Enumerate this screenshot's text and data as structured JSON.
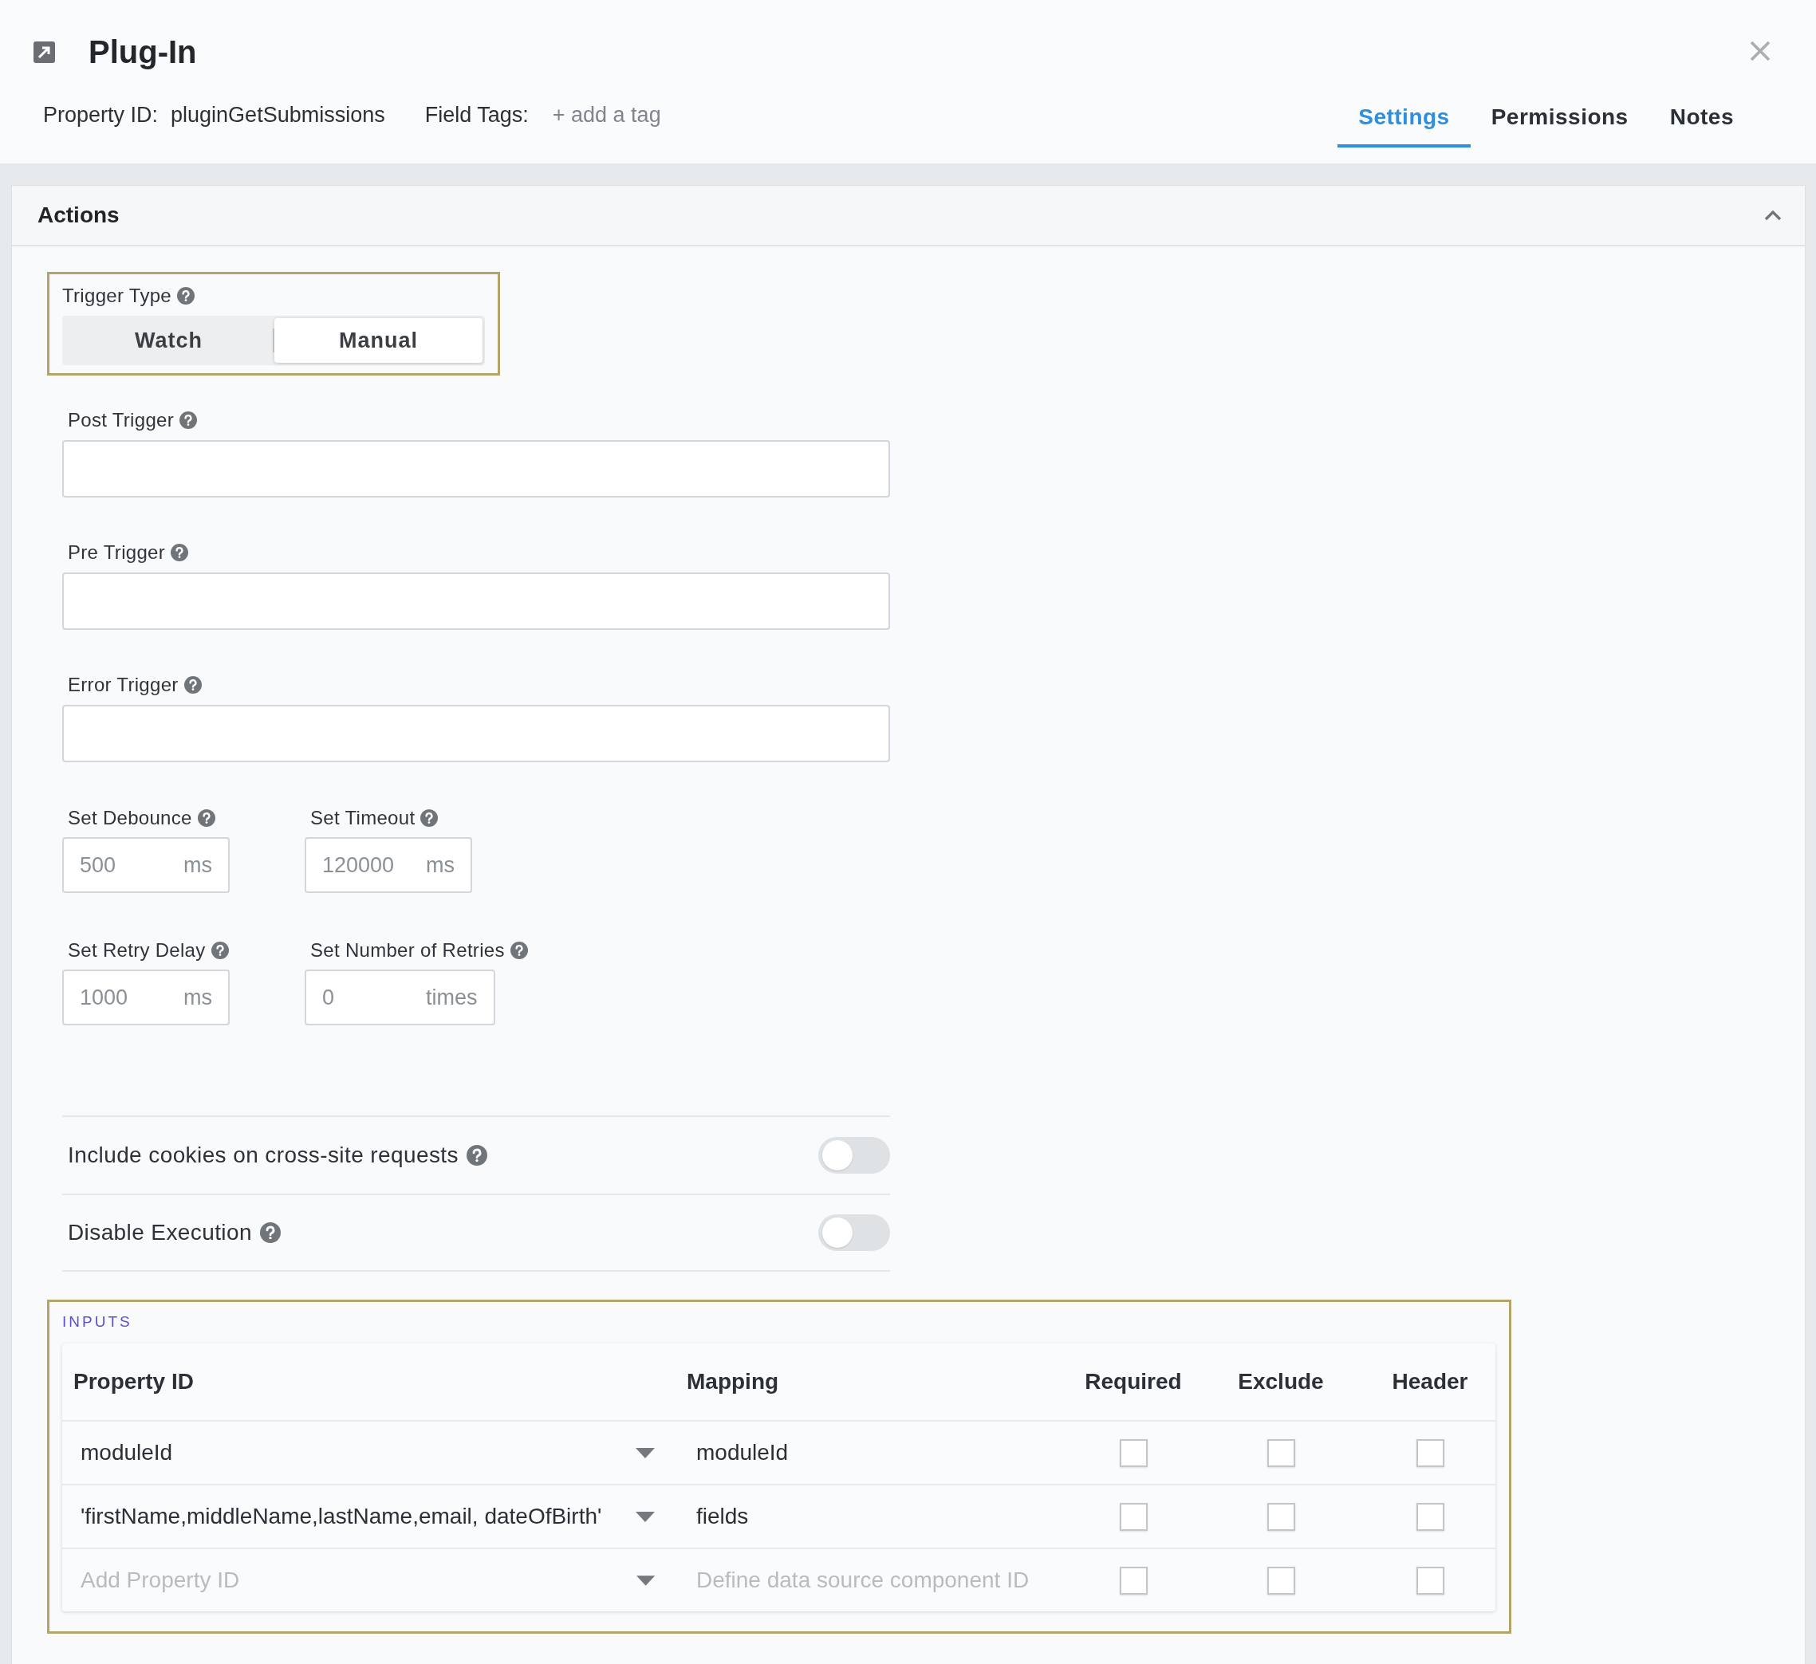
{
  "dialog": {
    "title": "Plug-In",
    "property_id_label": "Property ID:",
    "property_id": "pluginGetSubmissions",
    "field_tags_label": "Field Tags:",
    "add_tag": "+ add a tag"
  },
  "tabs": [
    {
      "label": "Settings",
      "selected": true
    },
    {
      "label": "Permissions",
      "selected": false
    },
    {
      "label": "Notes",
      "selected": false
    }
  ],
  "section": {
    "title": "Actions",
    "expanded": true
  },
  "trigger_type": {
    "label": "Trigger Type",
    "options": [
      {
        "label": "Watch",
        "selected": false
      },
      {
        "label": "Manual",
        "selected": true
      }
    ]
  },
  "text_fields": [
    {
      "label": "Post Trigger"
    },
    {
      "label": "Pre Trigger"
    },
    {
      "label": "Error Trigger"
    }
  ],
  "number_rows": [
    [
      {
        "label": "Set Debounce",
        "value": "500",
        "unit": "ms"
      },
      {
        "label": "Set Timeout",
        "value": "120000",
        "unit": "ms"
      }
    ],
    [
      {
        "label": "Set Retry Delay",
        "value": "1000",
        "unit": "ms"
      },
      {
        "label": "Set Number of Retries",
        "value": "0",
        "unit": "times"
      }
    ]
  ],
  "toggles": [
    {
      "label": "Include cookies on cross-site requests",
      "on": false
    },
    {
      "label": "Disable Execution",
      "on": false
    }
  ],
  "inputs": {
    "title": "INPUTS",
    "columns": [
      "Property ID",
      "Mapping",
      "Required",
      "Exclude",
      "Header"
    ],
    "rows": [
      {
        "property_id": "moduleId",
        "mapping": "moduleId",
        "required": false,
        "exclude": false,
        "header": false
      },
      {
        "property_id": "'firstName,middleName,lastName,email, dateOfBirth'",
        "mapping": "fields",
        "required": false,
        "exclude": false,
        "header": false
      },
      {
        "property_id_placeholder": "Add Property ID",
        "mapping_placeholder": "Define data source component ID",
        "required": false,
        "exclude": false,
        "header": false
      }
    ]
  }
}
